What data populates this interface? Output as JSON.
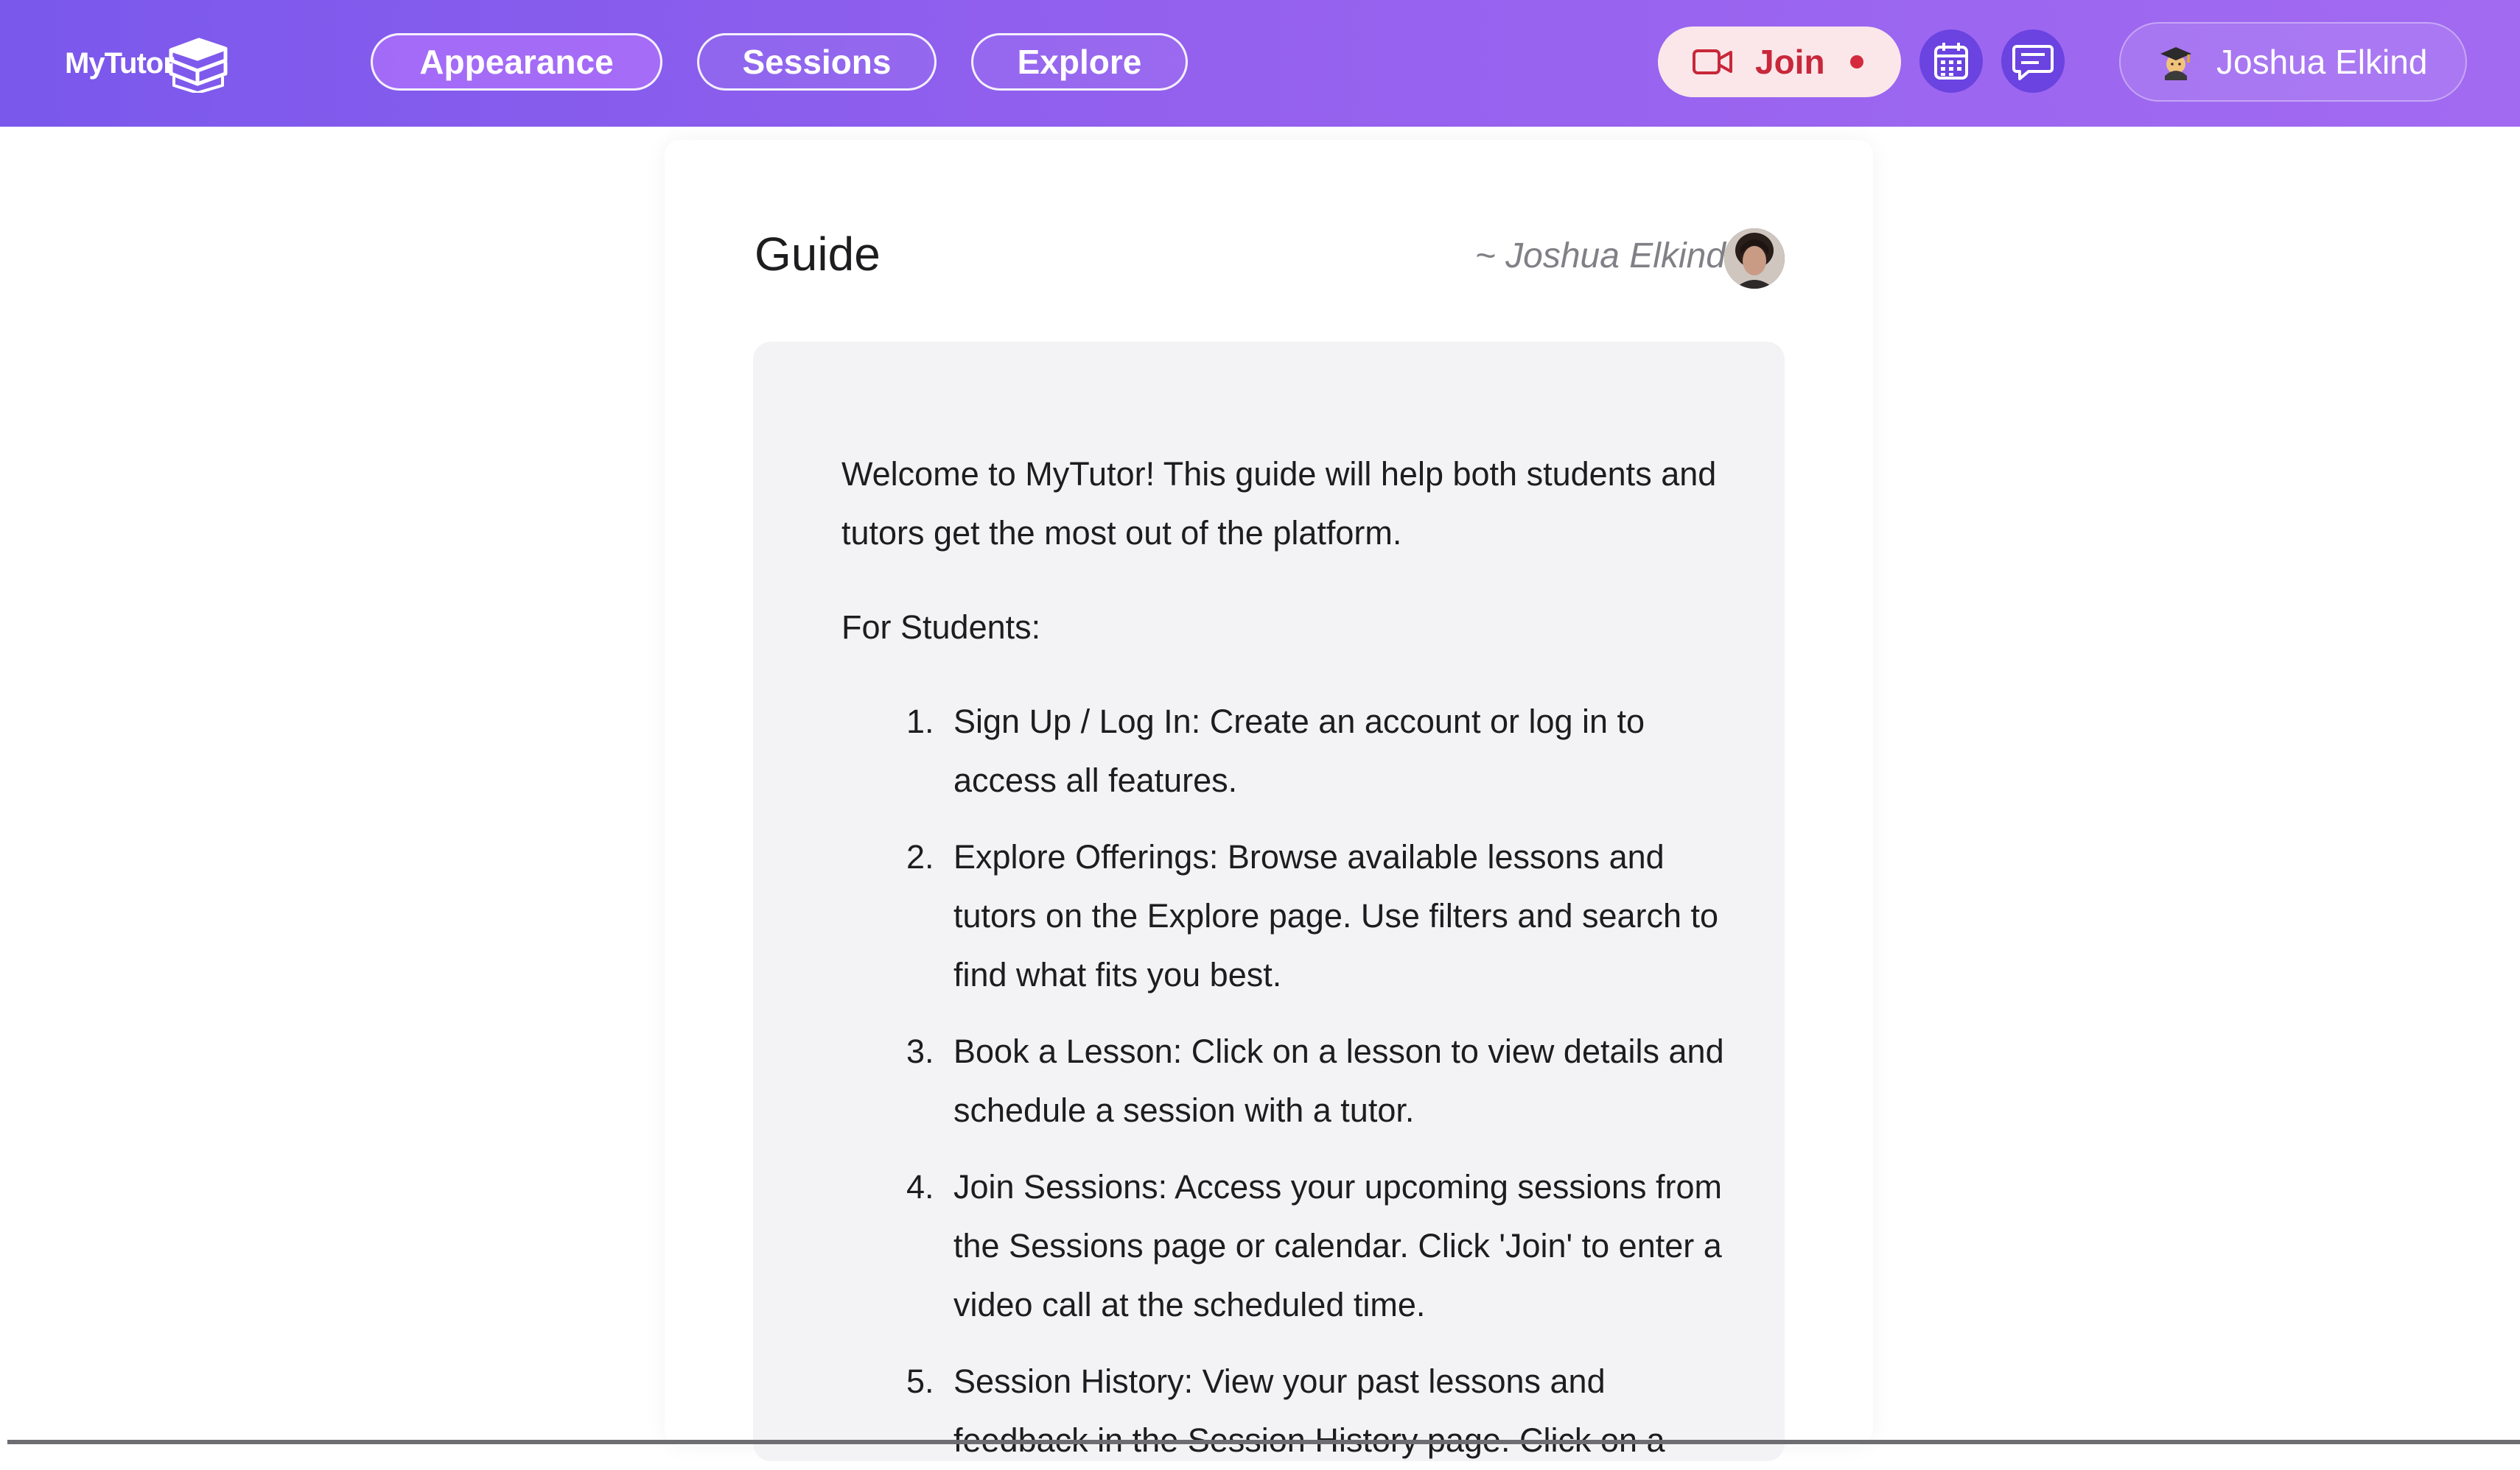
{
  "app": {
    "logo_text": "MyTutor"
  },
  "nav": {
    "appearance": "Appearance",
    "sessions": "Sessions",
    "explore": "Explore"
  },
  "header_actions": {
    "join_label": "Join",
    "user_name": "Joshua Elkind"
  },
  "guide": {
    "title": "Guide",
    "author": "~ Joshua Elkind",
    "intro": "Welcome to MyTutor! This guide will help both students and tutors get the most out of the platform.",
    "section_students": "For Students:",
    "steps": [
      {
        "num": "1.",
        "text": "Sign Up / Log In: Create an account or log in to access all features."
      },
      {
        "num": "2.",
        "text": "Explore Offerings: Browse available lessons and tutors on the Explore page. Use filters and search to find what fits you best."
      },
      {
        "num": "3.",
        "text": "Book a Lesson: Click on a lesson to view details and schedule a session with a tutor."
      },
      {
        "num": "4.",
        "text": "Join Sessions: Access your upcoming sessions from the Sessions page or calendar. Click 'Join' to enter a video call at the scheduled time."
      },
      {
        "num": "5.",
        "text": "Session History: View your past lessons and feedback in the Session History page. Click on a"
      }
    ]
  },
  "colors": {
    "topbar_start": "#7a58ec",
    "topbar_end": "#a26af1",
    "join_text": "#c8283a",
    "join_bg": "#fbe7ea",
    "icon_button_bg": "#6a43e0"
  },
  "icons": {
    "logo": "books-icon",
    "join": "video-camera-icon",
    "calendar": "calendar-icon",
    "chat": "chat-bubble-icon",
    "user": "graduate-emoji-icon"
  }
}
